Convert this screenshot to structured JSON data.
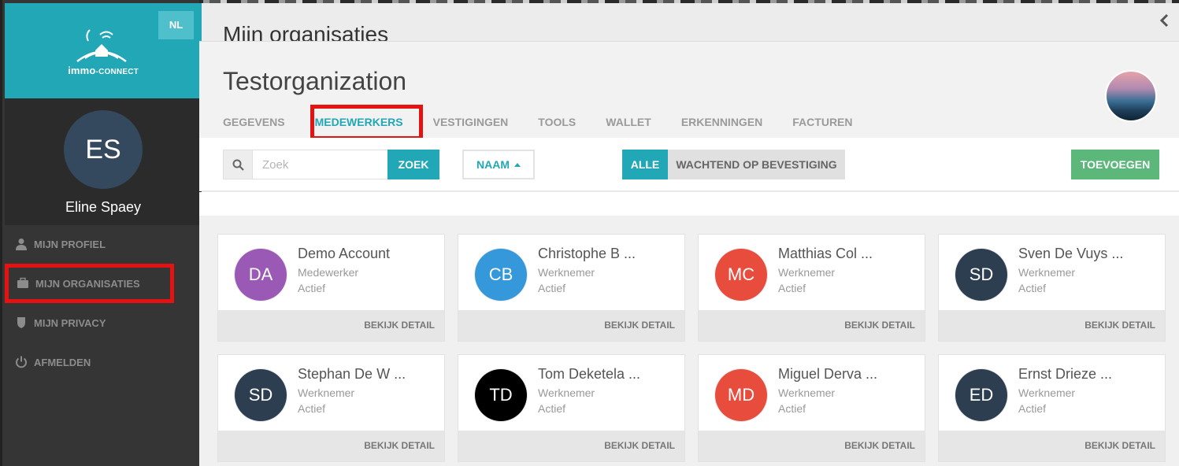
{
  "sidebar": {
    "brand": {
      "name": "immo",
      "suffix": "-CONNECT"
    },
    "language": "NL",
    "user": {
      "initials": "ES",
      "name": "Eline Spaey"
    },
    "nav": [
      {
        "label": "MIJN PROFIEL",
        "icon": "user-icon"
      },
      {
        "label": "MIJN ORGANISATIES",
        "icon": "briefcase-icon"
      },
      {
        "label": "MIJN PRIVACY",
        "icon": "shield-icon"
      },
      {
        "label": "AFMELDEN",
        "icon": "power-icon"
      }
    ]
  },
  "main": {
    "background_title": "Mijn organisaties",
    "org_title": "Testorganization",
    "tabs": [
      "GEGEVENS",
      "MEDEWERKERS",
      "VESTIGINGEN",
      "TOOLS",
      "WALLET",
      "ERKENNINGEN",
      "FACTUREN"
    ],
    "active_tab": "MEDEWERKERS"
  },
  "toolbar": {
    "search_placeholder": "Zoek",
    "search_button": "ZOEK",
    "sort_label": "NAAM",
    "filter_all": "ALLE",
    "filter_pending": "WACHTEND OP BEVESTIGING",
    "add_button": "TOEVOEGEN"
  },
  "members": [
    {
      "initials": "DA",
      "name": "Demo Account",
      "role": "Medewerker",
      "status": "Actief",
      "color": "#9b59b6",
      "detail": "BEKIJK DETAIL"
    },
    {
      "initials": "CB",
      "name": "Christophe B ...",
      "role": "Werknemer",
      "status": "Actief",
      "color": "#3498db",
      "detail": "BEKIJK DETAIL"
    },
    {
      "initials": "MC",
      "name": "Matthias Col ...",
      "role": "Werknemer",
      "status": "Actief",
      "color": "#e74c3c",
      "detail": "BEKIJK DETAIL"
    },
    {
      "initials": "SD",
      "name": "Sven De Vuys ...",
      "role": "Werknemer",
      "status": "Actief",
      "color": "#2c3e50",
      "detail": "BEKIJK DETAIL"
    },
    {
      "initials": "SD",
      "name": "Stephan De W ...",
      "role": "Werknemer",
      "status": "Actief",
      "color": "#2c3e50",
      "detail": "BEKIJK DETAIL"
    },
    {
      "initials": "TD",
      "name": "Tom Deketela ...",
      "role": "Werknemer",
      "status": "Actief",
      "color": "#000000",
      "detail": "BEKIJK DETAIL"
    },
    {
      "initials": "MD",
      "name": "Miguel Derva ...",
      "role": "Werknemer",
      "status": "Actief",
      "color": "#e74c3c",
      "detail": "BEKIJK DETAIL"
    },
    {
      "initials": "ED",
      "name": "Ernst Drieze ...",
      "role": "Werknemer",
      "status": "Actief",
      "color": "#2c3e50",
      "detail": "BEKIJK DETAIL"
    }
  ],
  "colors": {
    "accent": "#21a7b5",
    "add": "#5cb87a",
    "sidebar": "#353535",
    "highlight": "#e51212"
  }
}
